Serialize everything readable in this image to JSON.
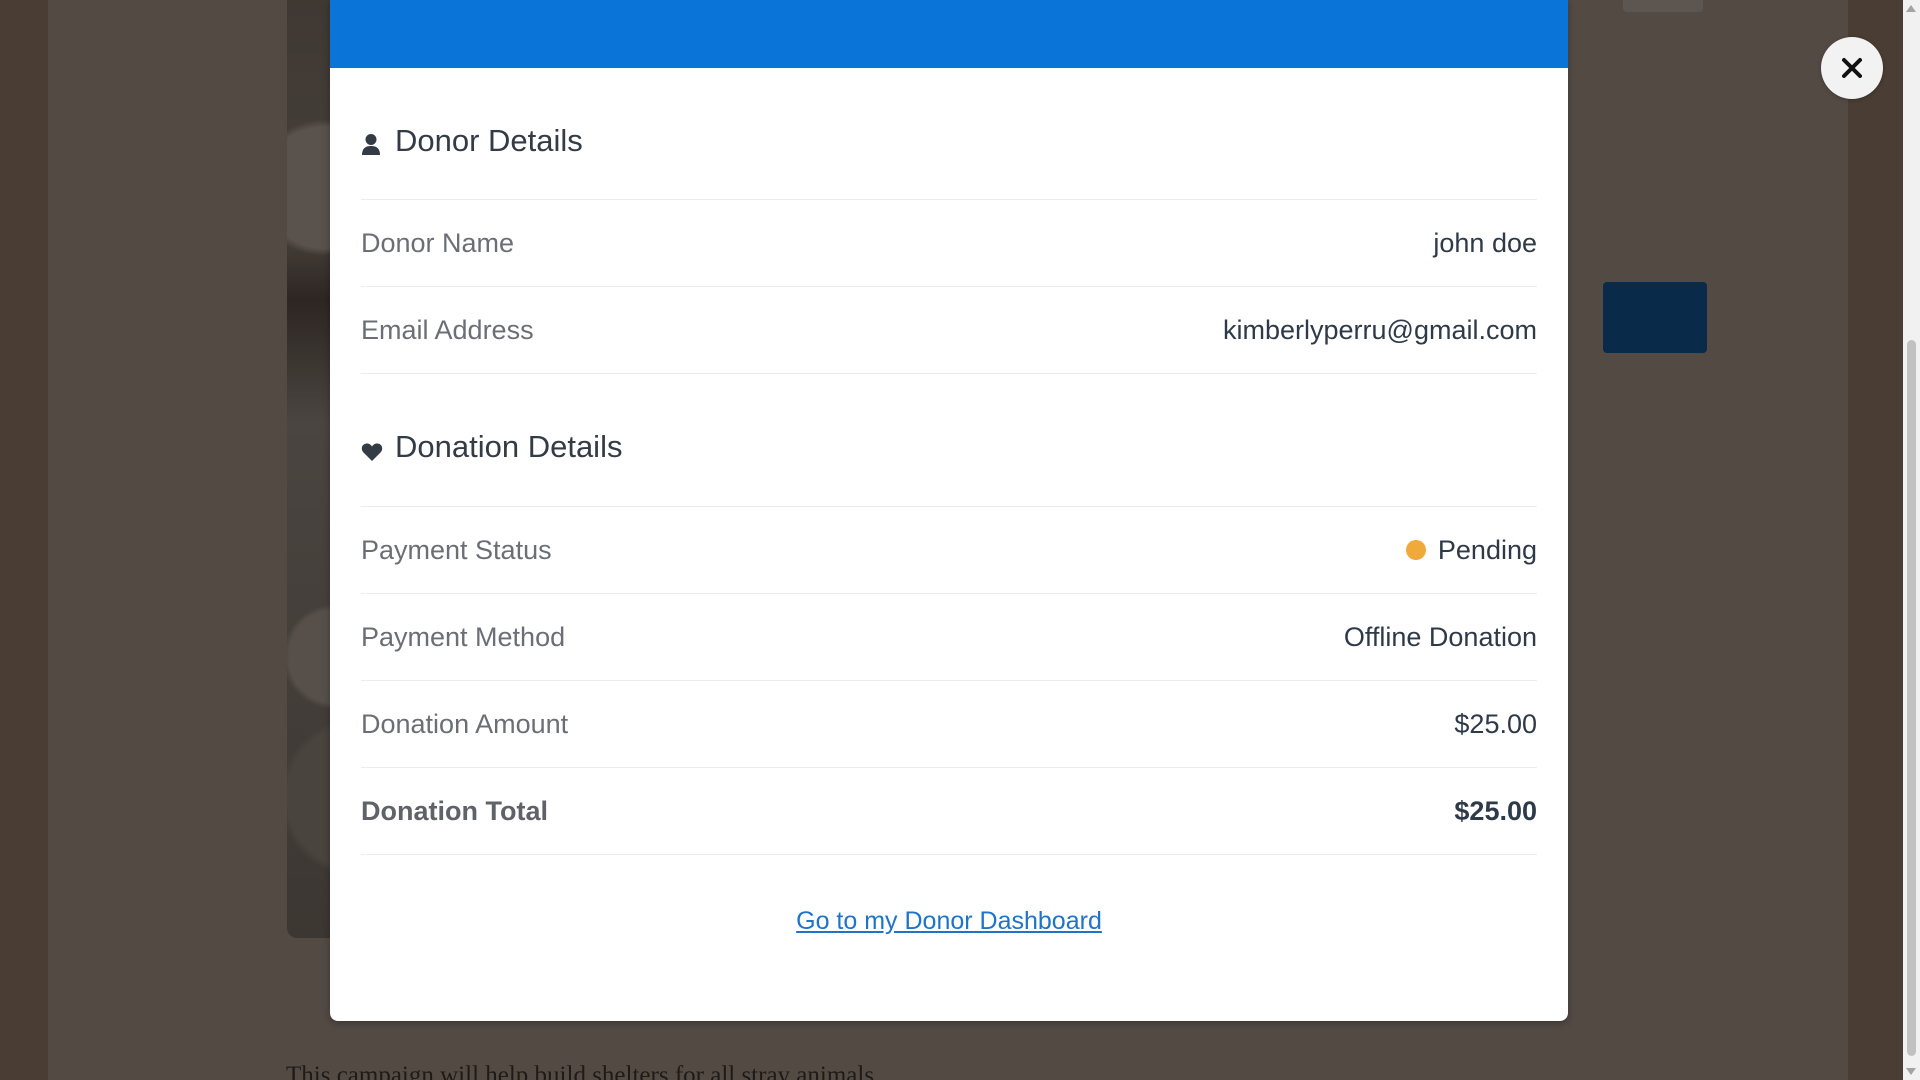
{
  "background": {
    "caption": "This campaign will help build shelters for all stray animals."
  },
  "close": {
    "icon": "close-icon"
  },
  "donor_section": {
    "heading": "Donor Details",
    "icon": "user-icon",
    "rows": [
      {
        "label": "Donor Name",
        "value": "john doe"
      },
      {
        "label": "Email Address",
        "value": "kimberlyperru@gmail.com"
      }
    ]
  },
  "donation_section": {
    "heading": "Donation Details",
    "icon": "heart-icon",
    "payment_status": {
      "label": "Payment Status",
      "value": "Pending",
      "color": "#f0a93b"
    },
    "payment_method": {
      "label": "Payment Method",
      "value": "Offline Donation"
    },
    "amount": {
      "label": "Donation Amount",
      "value": "$25.00"
    },
    "total": {
      "label": "Donation Total",
      "value": "$25.00"
    }
  },
  "footer": {
    "link_label": "Go to my Donor Dashboard"
  },
  "colors": {
    "header": "#0b74d9",
    "link": "#1f73c9",
    "pending": "#f0a93b"
  }
}
